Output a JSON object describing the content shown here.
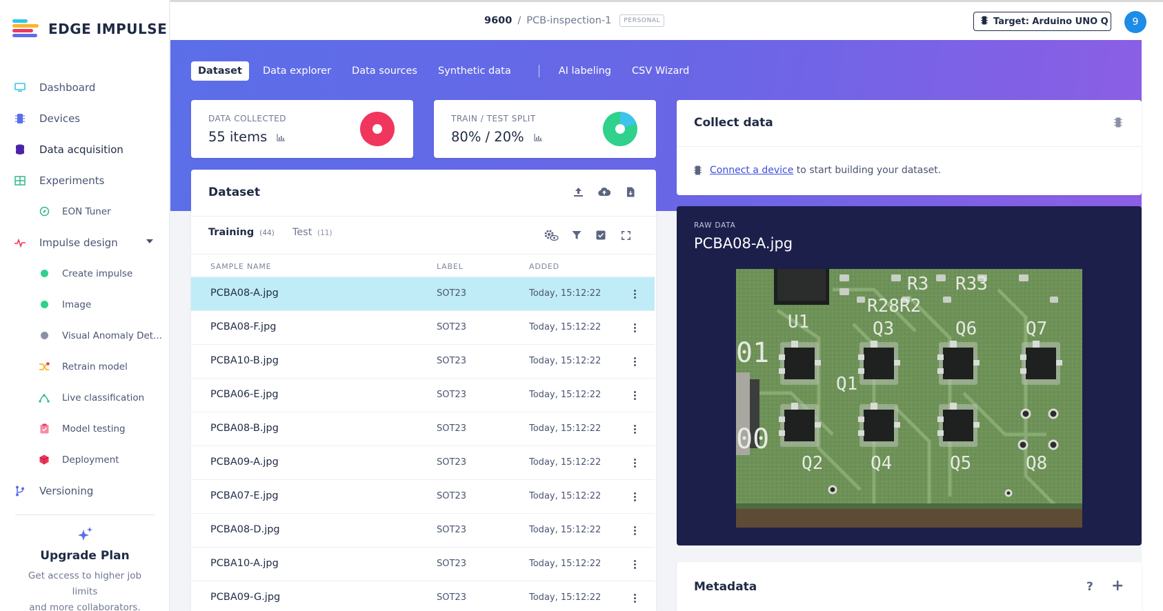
{
  "brand": {
    "name": "EDGE IMPULSE"
  },
  "sidebar": {
    "items": [
      {
        "label": "Dashboard"
      },
      {
        "label": "Devices"
      },
      {
        "label": "Data acquisition"
      },
      {
        "label": "Experiments"
      },
      {
        "label": "EON Tuner"
      },
      {
        "label": "Impulse design"
      },
      {
        "label": "Create impulse"
      },
      {
        "label": "Image"
      },
      {
        "label": "Visual Anomaly Det..."
      },
      {
        "label": "Retrain model"
      },
      {
        "label": "Live classification"
      },
      {
        "label": "Model testing"
      },
      {
        "label": "Deployment"
      },
      {
        "label": "Versioning"
      }
    ],
    "upgrade": {
      "title": "Upgrade Plan",
      "line1": "Get access to higher job limits",
      "line2": "and more collaborators."
    }
  },
  "header": {
    "project_id": "9600",
    "separator": "/",
    "project_name": "PCB-inspection-1",
    "project_badge": "PERSONAL",
    "target_label": "Target: Arduino UNO Q (...",
    "avatar_initial": "9"
  },
  "tabs": [
    {
      "label": "Dataset"
    },
    {
      "label": "Data explorer"
    },
    {
      "label": "Data sources"
    },
    {
      "label": "Synthetic data"
    },
    {
      "label": "AI labeling"
    },
    {
      "label": "CSV Wizard"
    }
  ],
  "stats": {
    "collected": {
      "label": "DATA COLLECTED",
      "value": "55 items"
    },
    "split": {
      "label": "TRAIN / TEST SPLIT",
      "value": "80% / 20%",
      "train_fraction": 0.8
    }
  },
  "dataset": {
    "title": "Dataset",
    "tabs": [
      {
        "label": "Training",
        "count": "(44)"
      },
      {
        "label": "Test",
        "count": "(11)"
      }
    ],
    "columns": {
      "name": "SAMPLE NAME",
      "label": "LABEL",
      "added": "ADDED"
    },
    "rows": [
      {
        "name": "PCBA08-A.jpg",
        "label": "SOT23",
        "added": "Today, 15:12:22"
      },
      {
        "name": "PCBA08-F.jpg",
        "label": "SOT23",
        "added": "Today, 15:12:22"
      },
      {
        "name": "PCBA10-B.jpg",
        "label": "SOT23",
        "added": "Today, 15:12:22"
      },
      {
        "name": "PCBA06-E.jpg",
        "label": "SOT23",
        "added": "Today, 15:12:22"
      },
      {
        "name": "PCBA08-B.jpg",
        "label": "SOT23",
        "added": "Today, 15:12:22"
      },
      {
        "name": "PCBA09-A.jpg",
        "label": "SOT23",
        "added": "Today, 15:12:22"
      },
      {
        "name": "PCBA07-E.jpg",
        "label": "SOT23",
        "added": "Today, 15:12:22"
      },
      {
        "name": "PCBA08-D.jpg",
        "label": "SOT23",
        "added": "Today, 15:12:22"
      },
      {
        "name": "PCBA10-A.jpg",
        "label": "SOT23",
        "added": "Today, 15:12:22"
      },
      {
        "name": "PCBA09-G.jpg",
        "label": "SOT23",
        "added": "Today, 15:12:22"
      }
    ]
  },
  "collect": {
    "title": "Collect data",
    "link_text": "Connect a device",
    "rest_text": " to start building your dataset."
  },
  "raw": {
    "label": "RAW DATA",
    "title": "PCBA08-A.jpg",
    "board_labels": [
      "R3",
      "R33",
      "R28R2",
      "U1",
      "Q3",
      "Q6",
      "Q7",
      "01",
      "Q1",
      "00",
      "Q2",
      "Q4",
      "Q5",
      "Q8"
    ]
  },
  "metadata": {
    "title": "Metadata",
    "help": "?",
    "add": "+"
  },
  "colors": {
    "accent": "#5b6ee8",
    "pie_collected": "#f0365d",
    "pie_train": "#2fd18b",
    "pie_test": "#3ec3ea",
    "selected_row": "#c0ecf7",
    "raw_bg": "#1b1f4a"
  },
  "icons": [
    "monitor-icon",
    "chip-icon",
    "database-icon",
    "grid-icon",
    "compass-icon",
    "pulse-icon",
    "shuffle-icon",
    "bezier-icon",
    "clipboard-icon",
    "cube-icon",
    "branch-icon",
    "sparkle-icon",
    "upload-icon",
    "cloud-icon",
    "file-icon",
    "settings-eye-icon",
    "filter-icon",
    "check-square-icon",
    "expand-icon",
    "kebab-icon"
  ]
}
